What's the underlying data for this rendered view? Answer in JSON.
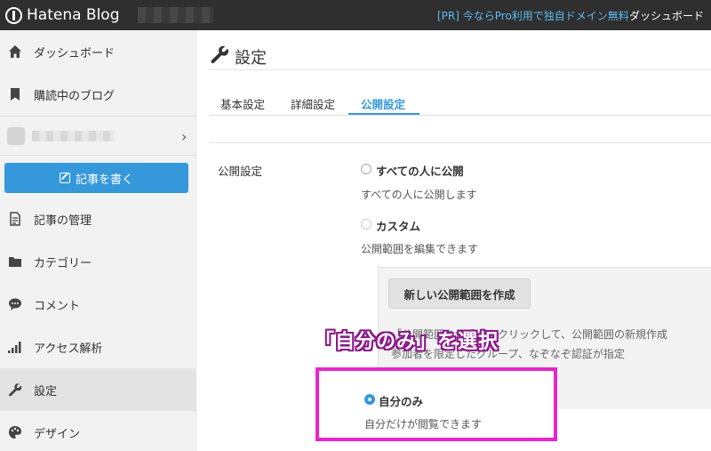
{
  "topbar": {
    "logo_text": "Hatena Blog",
    "promo_text": "[PR] 今ならPro利用で独自ドメイン無料",
    "dashboard_link": "ダッシュボード"
  },
  "sidebar": {
    "items": [
      {
        "label": "ダッシュボード",
        "icon": "home-icon"
      },
      {
        "label": "購読中のブログ",
        "icon": "bookmark-icon"
      },
      {
        "label": "記事の管理",
        "icon": "document-icon"
      },
      {
        "label": "カテゴリー",
        "icon": "folder-icon"
      },
      {
        "label": "コメント",
        "icon": "comment-icon"
      },
      {
        "label": "アクセス解析",
        "icon": "bar-chart-icon"
      },
      {
        "label": "設定",
        "icon": "wrench-icon",
        "active": true
      },
      {
        "label": "デザイン",
        "icon": "palette-icon"
      }
    ],
    "write_button": "記事を書く"
  },
  "main": {
    "title": "設定",
    "tabs": [
      {
        "label": "基本設定",
        "active": false
      },
      {
        "label": "詳細設定",
        "active": false
      },
      {
        "label": "公開設定",
        "active": true
      }
    ],
    "section_label": "公開設定",
    "options": [
      {
        "label": "すべての人に公開",
        "desc": "すべての人に公開します",
        "checked": false
      },
      {
        "label": "カスタム",
        "desc": "公開範囲を編集できます",
        "checked": false
      },
      {
        "label": "自分のみ",
        "desc": "自分だけが閲覧できます",
        "checked": true
      }
    ],
    "custom": {
      "new_range_button": "新しい公開範囲を作成",
      "help_line1": "「公開範囲を作成」をクリックして、公開範囲の新規作成",
      "help_line2": "参加者を限定したグループ、なぞなぞ認証が指定"
    }
  },
  "annotation": {
    "callout": "「自分のみ」を選択",
    "color": "#e925c9"
  },
  "colors": {
    "accent": "#3598db",
    "topbar": "#2f2f2f",
    "sidebar": "#f2f2f2"
  }
}
